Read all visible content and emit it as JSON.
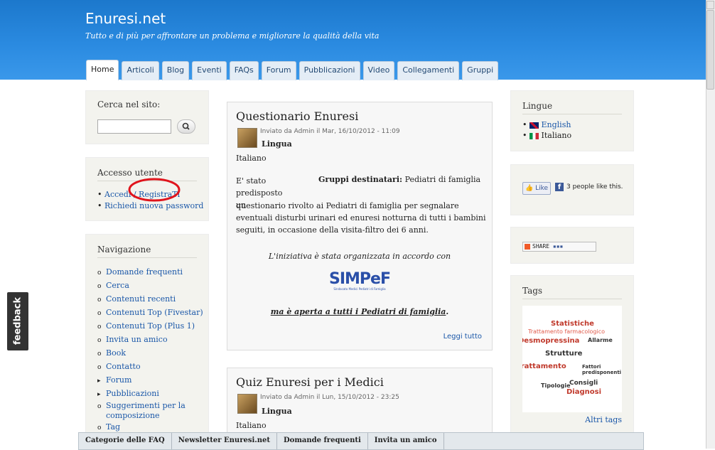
{
  "site": {
    "title": "Enuresi.net",
    "slogan": "Tutto e di più per affrontare un problema e migliorare la qualità della vita"
  },
  "tabs": [
    "Home",
    "Articoli",
    "Blog",
    "Eventi",
    "FAQs",
    "Forum",
    "Pubblicazioni",
    "Video",
    "Collegamenti",
    "Gruppi"
  ],
  "search": {
    "title": "Cerca nel sito:",
    "placeholder": "",
    "value": ""
  },
  "login": {
    "title": "Accesso utente",
    "items": [
      "Accedi / RegistraTi",
      "Richiedi nuova password"
    ]
  },
  "nav": {
    "title": "Navigazione",
    "items": [
      {
        "label": "Domande frequenti",
        "bullet": "o"
      },
      {
        "label": "Cerca",
        "bullet": "o"
      },
      {
        "label": "Contenuti recenti",
        "bullet": "o"
      },
      {
        "label": "Contenuti Top (Fivestar)",
        "bullet": "o"
      },
      {
        "label": "Contenuti Top (Plus 1)",
        "bullet": "o"
      },
      {
        "label": "Invita un amico",
        "bullet": "o"
      },
      {
        "label": "Book",
        "bullet": "o"
      },
      {
        "label": "Contatto",
        "bullet": "o"
      },
      {
        "label": "Forum",
        "bullet": "▸"
      },
      {
        "label": "Pubblicazioni",
        "bullet": "▸"
      },
      {
        "label": "Suggerimenti per la composizione",
        "bullet": "o"
      },
      {
        "label": "Tag",
        "bullet": "o"
      }
    ]
  },
  "post1": {
    "title": "Questionario Enuresi",
    "meta": "Inviato da Admin il Mar, 16/10/2012 - 11:09",
    "lang_label": "Lingua",
    "lang_value": "Italiano",
    "left_text": "E' stato predisposto un",
    "target_label": "Gruppi destinatari:",
    "target_value": "Pediatri di famiglia",
    "body": "questionario rivolto ai Pediatri di famiglia per segnalare eventuali disturbi urinari ed enuresi notturna di tutti i bambini seguiti, in occasione della visita-filtro dei 6 anni.",
    "quote": "L'iniziativa è stata organizzata in accordo con",
    "logo_text": "SIMPeF",
    "logo_sub": "Sindacato Medici Pediatri di Famiglia",
    "closing": "ma è aperta a tutti i Pediatri di famiglia",
    "read_more": "Leggi tutto"
  },
  "post2": {
    "title": "Quiz Enuresi per i Medici",
    "meta": "Inviato da Admin il Lun, 15/10/2012 - 23:25",
    "lang_label": "Lingua",
    "lang_value": "Italiano"
  },
  "languages": {
    "title": "Lingue",
    "items": [
      "English",
      "Italiano"
    ]
  },
  "like": {
    "button": "Like",
    "text": "3 people like this."
  },
  "share": {
    "label": "SHARE"
  },
  "tags": {
    "title": "Tags",
    "more": "Altri tags",
    "words": [
      "Statistiche",
      "Trattamento farmacologico",
      "Allarme",
      "Desmopressina",
      "Strutture",
      "Trattamento",
      "Fattori predisponenti",
      "Tipologie",
      "Consigli",
      "Diagnosi"
    ]
  },
  "footer": [
    "Categorie delle FAQ",
    "Newsletter Enuresi.net",
    "Domande frequenti",
    "Invita un amico"
  ],
  "feedback": "feedback",
  "colors": {
    "header": "#2a8ae0",
    "box": "#f3f3ee",
    "link": "#1a57a8",
    "highlight": "#e0141c"
  }
}
